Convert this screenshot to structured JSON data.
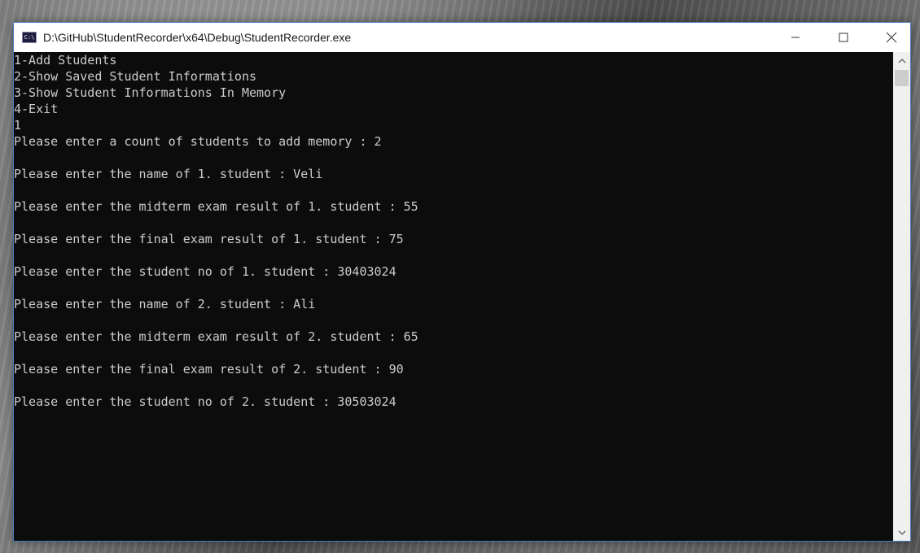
{
  "window": {
    "title": "D:\\GitHub\\StudentRecorder\\x64\\Debug\\StudentRecorder.exe",
    "icon_glyph": "C:\\",
    "icon": "console-app-icon"
  },
  "caption_buttons": {
    "minimize": "minimize-icon",
    "maximize": "maximize-icon",
    "close": "close-icon"
  },
  "console": {
    "lines": [
      "1-Add Students",
      "2-Show Saved Student Informations",
      "3-Show Student Informations In Memory",
      "4-Exit",
      "1",
      "Please enter a count of students to add memory : 2",
      "",
      "Please enter the name of 1. student : Veli",
      "",
      "Please enter the midterm exam result of 1. student : 55",
      "",
      "Please enter the final exam result of 1. student : 75",
      "",
      "Please enter the student no of 1. student : 30403024",
      "",
      "Please enter the name of 2. student : Ali",
      "",
      "Please enter the midterm exam result of 2. student : 65",
      "",
      "Please enter the final exam result of 2. student : 90",
      "",
      "Please enter the student no of 2. student : 30503024"
    ],
    "background": "#0c0c0c",
    "foreground": "#cccccc"
  },
  "scrollbar": {
    "up_arrow": "chevron-up-icon",
    "down_arrow": "chevron-down-icon"
  }
}
